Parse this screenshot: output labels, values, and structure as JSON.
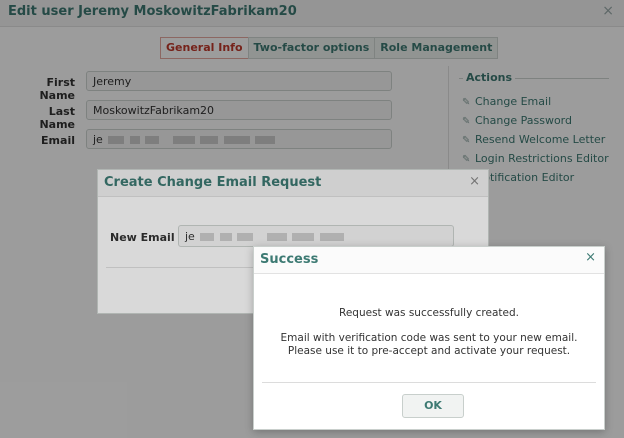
{
  "base": {
    "title": "Edit user Jeremy MoskowitzFabrikam20",
    "close": "×",
    "tabs": [
      {
        "label": "General Info",
        "active": true
      },
      {
        "label": "Two-factor options",
        "active": false
      },
      {
        "label": "Role Management",
        "active": false
      }
    ],
    "fields": {
      "first_name_label": "First Name",
      "first_name_value": "Jeremy",
      "last_name_label": "Last Name",
      "last_name_value": "MoskowitzFabrikam20",
      "email_label": "Email",
      "email_value_prefix": "je"
    },
    "actions": {
      "title": "Actions",
      "items": [
        {
          "label": "Change Email",
          "icon": "pencil-icon"
        },
        {
          "label": "Change Password",
          "icon": "pencil-icon"
        },
        {
          "label": "Resend Welcome Letter",
          "icon": "pencil-icon"
        },
        {
          "label": "Login Restrictions Editor",
          "icon": "pencil-icon"
        },
        {
          "label": "Notification Editor",
          "icon": "pencil-icon"
        }
      ]
    }
  },
  "change_email_dialog": {
    "title": "Create Change Email Request",
    "close": "×",
    "new_email_label": "New Email",
    "new_email_prefix": "je"
  },
  "success_dialog": {
    "title": "Success",
    "close": "×",
    "message_line1": "Request was successfully created.",
    "message_line2": "Email with verification code was sent to your new email.",
    "message_line3": "Please use it to pre-accept and activate your request.",
    "ok_label": "OK"
  },
  "colors": {
    "accent": "#3d7a73",
    "active_tab": "#c0392b"
  }
}
